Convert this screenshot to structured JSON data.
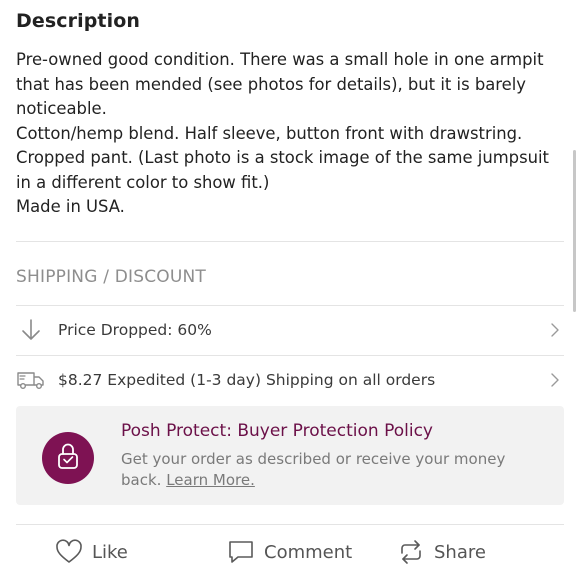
{
  "description": {
    "title": "Description",
    "lines": [
      "Pre-owned good condition. There was a small hole in one armpit that has been mended (see photos for details), but it is barely noticeable.",
      "Cotton/hemp blend. Half sleeve, button front with drawstring. Cropped pant. (Last photo is a stock image of the same jumpsuit in a different color to show fit.)",
      "Made in USA."
    ]
  },
  "shipping": {
    "heading": "SHIPPING / DISCOUNT",
    "rows": [
      {
        "icon": "arrow-down-icon",
        "label": "Price Dropped: 60%"
      },
      {
        "icon": "truck-icon",
        "label": "$8.27 Expedited (1-3 day) Shipping on all orders"
      }
    ]
  },
  "protect": {
    "title": "Posh Protect: Buyer Protection Policy",
    "text": "Get your order as described or receive your money back.",
    "link": "Learn More.",
    "badge_color": "#7e1253",
    "title_color": "#6b1048"
  },
  "actions": {
    "like": "Like",
    "comment": "Comment",
    "share": "Share"
  }
}
